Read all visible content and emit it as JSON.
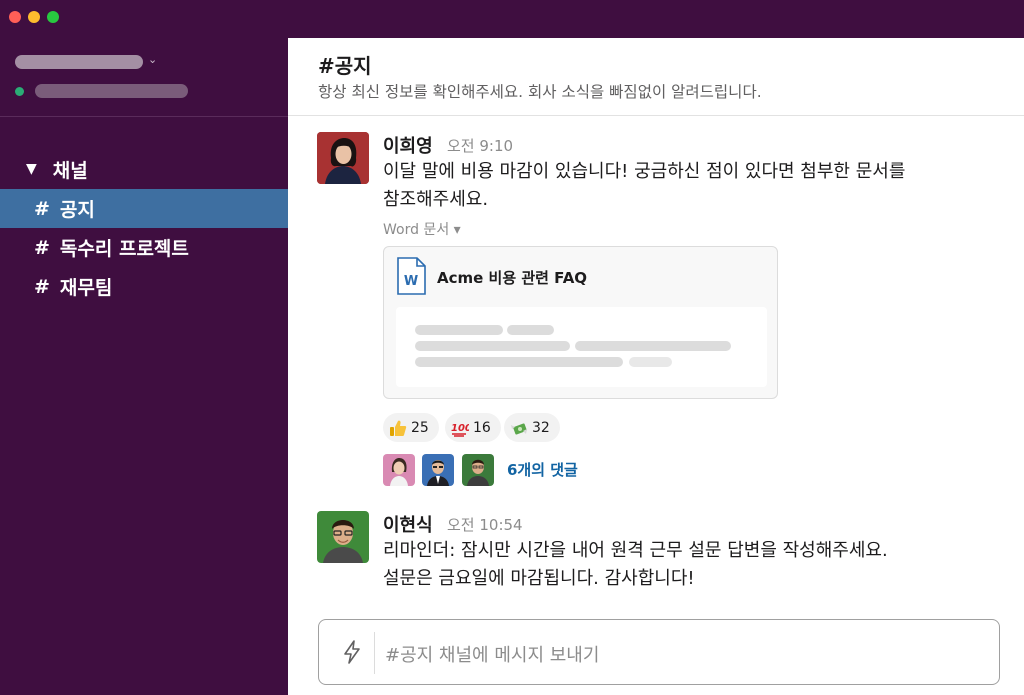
{
  "sidebar": {
    "section_header": "채널",
    "channels": [
      {
        "hash": "#",
        "name": "공지"
      },
      {
        "hash": "#",
        "name": "독수리 프로젝트"
      },
      {
        "hash": "#",
        "name": "재무팀"
      }
    ]
  },
  "channel": {
    "title": "#공지",
    "topic": "항상 최신 정보를 확인해주세요. 회사 소식을 빠짐없이 알려드립니다."
  },
  "messages": [
    {
      "author": "이희영",
      "time": "오전 9:10",
      "text_line1": "이달 말에 비용 마감이 있습니다! 궁금하신 점이 있다면 첨부한 문서를",
      "text_line2": "참조해주세요.",
      "file": {
        "type_label": "Word 문서 ▾",
        "name": "Acme 비용 관련 FAQ",
        "icon_letter": "W"
      },
      "reactions": [
        {
          "emoji": "thumbs-up",
          "count": "25"
        },
        {
          "emoji": "hundred-points",
          "count": "16"
        },
        {
          "emoji": "money-with-wings",
          "count": "32"
        }
      ],
      "replies_label": "6개의 댓글"
    },
    {
      "author": "이현식",
      "time": "오전 10:54",
      "text_line1": "리마인더: 잠시만 시간을 내어 원격 근무 설문 답변을 작성해주세요.",
      "text_line2": "설문은 금요일에 마감됩니다. 감사합니다!"
    }
  ],
  "composer": {
    "placeholder": "#공지 채널에 메시지 보내기"
  },
  "colors": {
    "sidebar": "#3f0e40",
    "active_channel": "#3e6fa1",
    "link": "#1264a3",
    "online": "#2bac76"
  }
}
